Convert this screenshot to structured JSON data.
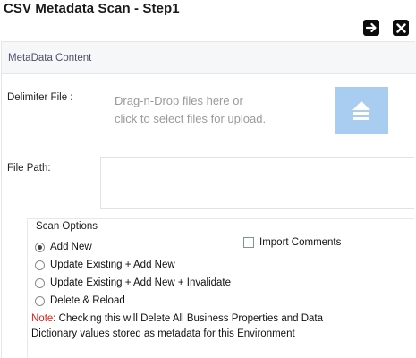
{
  "window": {
    "title": "CSV Metadata Scan - Step1"
  },
  "toolbar": {
    "next_icon": "arrow-right-icon",
    "close_icon": "close-x-icon"
  },
  "section": {
    "title": "MetaData Content"
  },
  "delimiter": {
    "label": "Delimiter File :",
    "drop_line1": "Drag-n-Drop files here or",
    "drop_line2": "click to select files for upload.",
    "upload_icon": "upload-icon",
    "upload_tile_color": "#a8cdf0"
  },
  "file_path": {
    "label": "File Path:",
    "value": ""
  },
  "scan_options": {
    "title": "Scan Options",
    "options": [
      {
        "label": "Add New",
        "selected": true
      },
      {
        "label": "Update Existing + Add New",
        "selected": false
      },
      {
        "label": "Update Existing + Add New + Invalidate",
        "selected": false
      },
      {
        "label": "Delete & Reload",
        "selected": false
      }
    ],
    "import_comments": {
      "label": "Import Comments",
      "checked": false
    }
  },
  "note": {
    "prefix": "Note",
    "text": ": Checking this will Delete All Business Properties and Data Dictionary values stored as metadata for this Environment",
    "accent_color": "#e0201b"
  }
}
